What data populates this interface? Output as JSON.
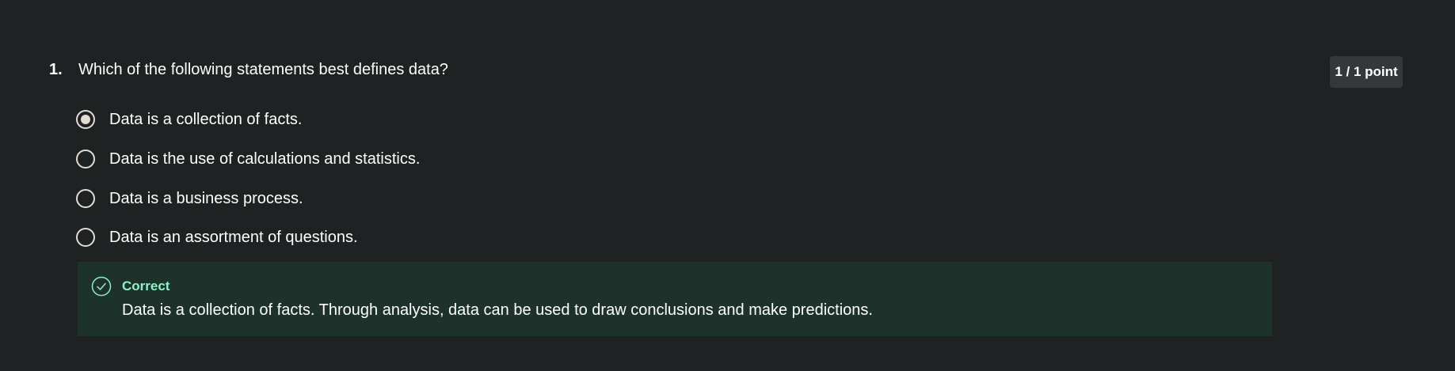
{
  "question": {
    "number": "1.",
    "text": "Which of the following statements best defines data?",
    "points": "1 / 1 point",
    "options": [
      {
        "label": "Data is a collection of facts.",
        "selected": true
      },
      {
        "label": "Data is the use of calculations and statistics.",
        "selected": false
      },
      {
        "label": "Data is a business process.",
        "selected": false
      },
      {
        "label": "Data is an assortment of questions.",
        "selected": false
      }
    ],
    "feedback": {
      "icon": "check-circle-icon",
      "status": "Correct",
      "text": "Data is a collection of facts. Through analysis, data can be used to draw conclusions and make predictions."
    }
  },
  "colors": {
    "background": "#1f2223",
    "badge_bg": "#34383a",
    "feedback_bg": "#1c322b",
    "correct": "#8ff0c8",
    "radio": "#e3dcd2"
  }
}
